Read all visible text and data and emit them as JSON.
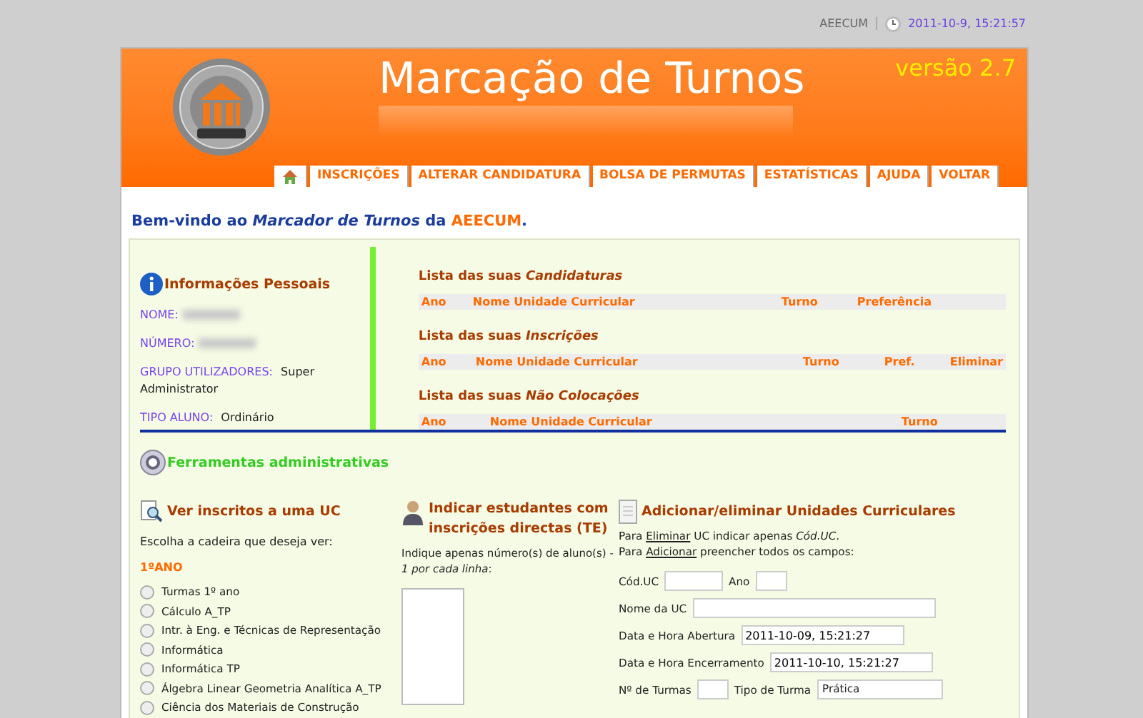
{
  "top_bar": {
    "site": "AEECUM",
    "datetime": "2011-10-9, 15:21:57"
  },
  "header": {
    "title": "Marcação de Turnos",
    "version": "versão 2.7"
  },
  "tabs": [
    {
      "kind": "home",
      "selected": false
    },
    {
      "kind": "text",
      "label": "INSCRIÇÕES",
      "selected": false
    },
    {
      "kind": "text",
      "label": "ALTERAR CANDIDATURA",
      "selected": false
    },
    {
      "kind": "text",
      "label": "BOLSA DE PERMUTAS",
      "selected": false
    },
    {
      "kind": "text",
      "label": "ESTATÍSTICAS",
      "selected": false
    },
    {
      "kind": "text",
      "label": "AJUDA",
      "selected": false
    },
    {
      "kind": "text",
      "label": "VOLTAR",
      "selected": false
    }
  ],
  "welcome": "Bem-vindo ao *Marcador de Turnos* da ",
  "welcome_brand": "AEECUM",
  "welcome_end": ".",
  "personal_info": {
    "title": "Informações Pessoais",
    "fields": [
      {
        "label": "NOME:",
        "blurred": true
      },
      {
        "label": "NÚMERO:",
        "blurred": true
      },
      {
        "label": "GRUPO UTILIZADORES:",
        "value": "Super Administrator"
      },
      {
        "label": "TIPO ALUNO:",
        "value": "Ordinário"
      }
    ]
  },
  "lists": [
    {
      "title": "Lista das suas *Candidaturas*",
      "columns": [
        "Ano",
        "Nome Unidade Curricular",
        "Turno",
        "Preferência"
      ]
    },
    {
      "title": "Lista das suas *Inscrições*",
      "columns": [
        "Ano",
        "Nome Unidade Curricular",
        "Turno",
        "Pref.",
        "Eliminar"
      ]
    },
    {
      "title": "Lista das suas *Não Colocações*",
      "columns": [
        "Ano",
        "Nome Unidade Curricular",
        "Turno"
      ]
    }
  ],
  "admin": {
    "title": "Ferramentas administrativas",
    "view": {
      "title": "Ver inscritos a uma UC",
      "prompt": "Escolha a cadeira que deseja ver:",
      "year": "1ºANO",
      "options": [
        {
          "label": "Turmas 1º ano",
          "checked": false
        },
        {
          "label": "Cálculo A_TP",
          "checked": false
        },
        {
          "label": "Intr. à Eng. e Técnicas de Representação",
          "checked": false
        },
        {
          "label": "Informática",
          "checked": false
        },
        {
          "label": "Informática TP",
          "checked": false
        },
        {
          "label": "Álgebra Linear Geometria Analítica A_TP",
          "checked": false
        },
        {
          "label": "Ciência dos Materiais de Construção",
          "checked": false
        }
      ]
    },
    "direct": {
      "title": "Indicar estudantes com inscrições directas (TE)",
      "hint": "Indique apenas número(s) de aluno(s) -",
      "hint2": "*1 por cada linha*:"
    },
    "manage": {
      "title": "Adicionar/eliminar Unidades Curriculares",
      "lines": [
        {
          "before": "Para ",
          "link": "Eliminar",
          "after": " UC indicar apenas *Cód.UC*."
        },
        {
          "before": "Para ",
          "link": "Adicionar",
          "after": " preencher todos os campos:"
        }
      ],
      "fields": [
        {
          "kind": "input",
          "label": "Cód.UC"
        },
        {
          "kind": "input",
          "label": "Ano"
        },
        {
          "kind": "input",
          "label": "Nome da UC"
        },
        {
          "kind": "input",
          "label": "Data e Hora Abertura",
          "value": "2011-10-09, 15:21:27"
        },
        {
          "kind": "input",
          "label": "Data e Hora Encerramento",
          "value": "2011-10-10, 15:21:27"
        },
        {
          "kind": "input",
          "label": "Nº de Turmas"
        },
        {
          "kind": "dropdown",
          "label": "Tipo de Turma",
          "value": "Prática"
        }
      ]
    }
  }
}
